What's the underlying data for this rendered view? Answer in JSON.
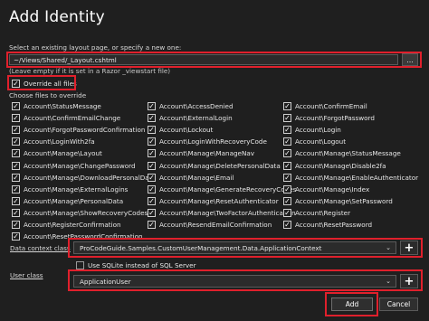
{
  "dialog": {
    "title": "Add Identity"
  },
  "layout": {
    "label": "Select an existing layout page, or specify a new one:",
    "value": "~/Views/Shared/_Layout.cshtml",
    "browse_label": "...",
    "hint": "(Leave empty if it is set in a Razor _viewstart file)"
  },
  "override": {
    "label": "Override all files",
    "checked": true
  },
  "files": {
    "label": "Choose files to override",
    "items": [
      "Account\\StatusMessage",
      "Account\\AccessDenied",
      "Account\\ConfirmEmail",
      "Account\\ConfirmEmailChange",
      "Account\\ExternalLogin",
      "Account\\ForgotPassword",
      "Account\\ForgotPasswordConfirmation",
      "Account\\Lockout",
      "Account\\Login",
      "Account\\LoginWith2fa",
      "Account\\LoginWithRecoveryCode",
      "Account\\Logout",
      "Account\\Manage\\Layout",
      "Account\\Manage\\ManageNav",
      "Account\\Manage\\StatusMessage",
      "Account\\Manage\\ChangePassword",
      "Account\\Manage\\DeletePersonalData",
      "Account\\Manage\\Disable2fa",
      "Account\\Manage\\DownloadPersonalData",
      "Account\\Manage\\Email",
      "Account\\Manage\\EnableAuthenticator",
      "Account\\Manage\\ExternalLogins",
      "Account\\Manage\\GenerateRecoveryCodes",
      "Account\\Manage\\Index",
      "Account\\Manage\\PersonalData",
      "Account\\Manage\\ResetAuthenticator",
      "Account\\Manage\\SetPassword",
      "Account\\Manage\\ShowRecoveryCodes",
      "Account\\Manage\\TwoFactorAuthentication",
      "Account\\Register",
      "Account\\RegisterConfirmation",
      "Account\\ResendEmailConfirmation",
      "Account\\ResetPassword",
      "Account\\ResetPasswordConfirmation"
    ]
  },
  "data_context": {
    "label": "Data context class",
    "value": "ProCodeGuide.Samples.CustomUserManagement.Data.ApplicationContext",
    "add_label": "+"
  },
  "sqlite": {
    "label": "Use SQLite instead of SQL Server",
    "checked": false
  },
  "user_class": {
    "label": "User class",
    "value": "ApplicationUser",
    "add_label": "+"
  },
  "buttons": {
    "add": "Add",
    "cancel": "Cancel"
  },
  "colors": {
    "highlight": "#e0202c",
    "background": "#1f1f1f"
  },
  "icons": {
    "check": "check-icon",
    "dropdown": "chevron-down-icon",
    "add": "plus-icon"
  }
}
